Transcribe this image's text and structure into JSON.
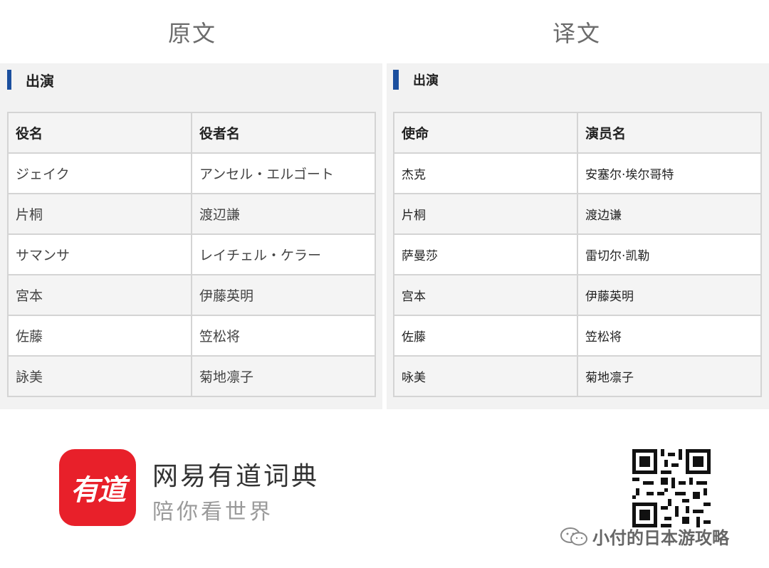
{
  "headers": {
    "original": "原文",
    "translation": "译文"
  },
  "original": {
    "section": "出演",
    "columns": [
      "役名",
      "役者名"
    ],
    "rows": [
      [
        "ジェイク",
        "アンセル・エルゴート"
      ],
      [
        "片桐",
        "渡辺謙"
      ],
      [
        "サマンサ",
        "レイチェル・ケラー"
      ],
      [
        "宮本",
        "伊藤英明"
      ],
      [
        "佐藤",
        "笠松将"
      ],
      [
        "詠美",
        "菊地凛子"
      ]
    ]
  },
  "translation": {
    "section": "出演",
    "columns": [
      "使命",
      "演员名"
    ],
    "rows": [
      [
        "杰克",
        "安塞尔·埃尔哥特"
      ],
      [
        "片桐",
        "渡边谦"
      ],
      [
        "萨曼莎",
        "雷切尔·凯勒"
      ],
      [
        "宫本",
        "伊藤英明"
      ],
      [
        "佐藤",
        "笠松将"
      ],
      [
        "咏美",
        "菊地凛子"
      ]
    ]
  },
  "footer": {
    "logo_text": "有道",
    "brand_name": "网易有道词典",
    "slogan": "陪你看世界",
    "account": "小付的日本游攻略",
    "accent_color": "#e8202a",
    "section_bar_color": "#1b4f9e"
  }
}
